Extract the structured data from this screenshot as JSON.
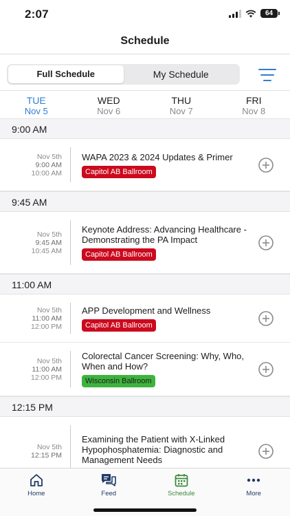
{
  "status_bar": {
    "time": "2:07",
    "battery": "64"
  },
  "nav": {
    "title": "Schedule"
  },
  "segment": {
    "full_label": "Full Schedule",
    "my_label": "My Schedule"
  },
  "days": [
    {
      "name": "TUE",
      "date": "Nov 5"
    },
    {
      "name": "WED",
      "date": "Nov 6"
    },
    {
      "name": "THU",
      "date": "Nov 7"
    },
    {
      "name": "FRI",
      "date": "Nov 8"
    }
  ],
  "groups": [
    {
      "time": "9:00 AM",
      "sessions": [
        {
          "date": "Nov 5th",
          "start": "9:00 AM",
          "end": "10:00 AM",
          "title": "WAPA 2023 & 2024 Updates & Primer",
          "room": "Capitol AB Ballroom"
        }
      ]
    },
    {
      "time": "9:45 AM",
      "sessions": [
        {
          "date": "Nov 5th",
          "start": "9:45 AM",
          "end": "10:45 AM",
          "title": "Keynote Address: Advancing Healthcare - Demonstrating the PA Impact",
          "room": "Capitol AB Ballroom"
        }
      ]
    },
    {
      "time": "11:00 AM",
      "sessions": [
        {
          "date": "Nov 5th",
          "start": "11:00 AM",
          "end": "12:00 PM",
          "title": "APP Development and Wellness",
          "room": "Capitol AB Ballroom"
        },
        {
          "date": "Nov 5th",
          "start": "11:00 AM",
          "end": "12:00 PM",
          "title": "Colorectal Cancer Screening: Why, Who, When and How?",
          "room": "Wisconsin Ballroom"
        }
      ]
    },
    {
      "time": "12:15 PM",
      "sessions": [
        {
          "date": "Nov 5th",
          "start": "12:15 PM",
          "end": "",
          "title": "Examining the Patient with X-Linked Hypophosphatemia: Diagnostic and Management Needs",
          "room": ""
        }
      ]
    }
  ],
  "tabs": {
    "home": "Home",
    "feed": "Feed",
    "schedule": "Schedule",
    "more": "More"
  },
  "colors": {
    "accent_blue": "#2f7fd0",
    "room_red": "#cc0a1e",
    "room_green": "#3db43d",
    "tab_active": "#3b8a3b",
    "tab_inactive": "#1f3a66"
  }
}
